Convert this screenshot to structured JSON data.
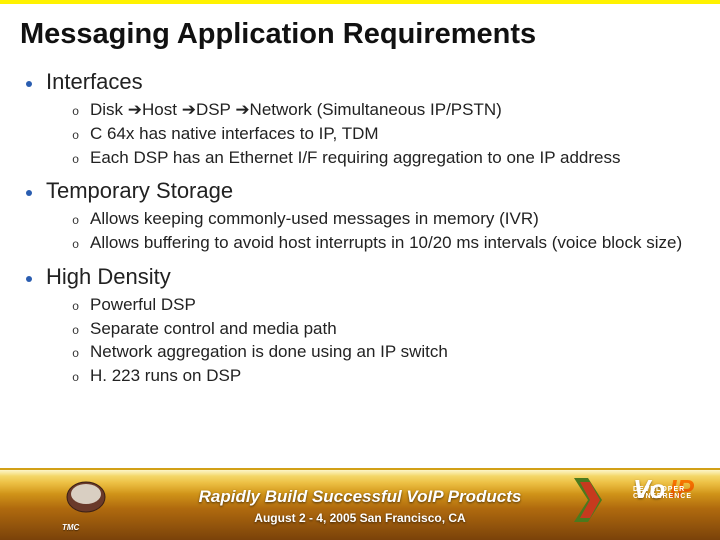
{
  "title": "Messaging Application Requirements",
  "sections": [
    {
      "label": "Interfaces",
      "items": [
        "Disk ➔Host ➔DSP ➔Network (Simultaneous IP/PSTN)",
        "C 64x has native interfaces to IP, TDM",
        "Each DSP has an Ethernet I/F requiring aggregation to one IP address"
      ]
    },
    {
      "label": "Temporary Storage",
      "items": [
        "Allows keeping commonly-used messages in memory (IVR)",
        "Allows buffering to avoid host interrupts in 10/20 ms intervals (voice block size)"
      ]
    },
    {
      "label": "High Density",
      "items": [
        "Powerful DSP",
        "Separate control and media path",
        "Network aggregation is done using an IP switch",
        "H. 223 runs on DSP"
      ]
    }
  ],
  "footer": {
    "headline": "Rapidly Build Successful VoIP Products",
    "sub": "August 2 - 4, 2005 San Francisco, CA",
    "left_logo_text": "TMC",
    "right_logo_v": "Vo",
    "right_logo_ip": "IP",
    "right_logo_small": "DEVELOPER CONFERENCE"
  }
}
